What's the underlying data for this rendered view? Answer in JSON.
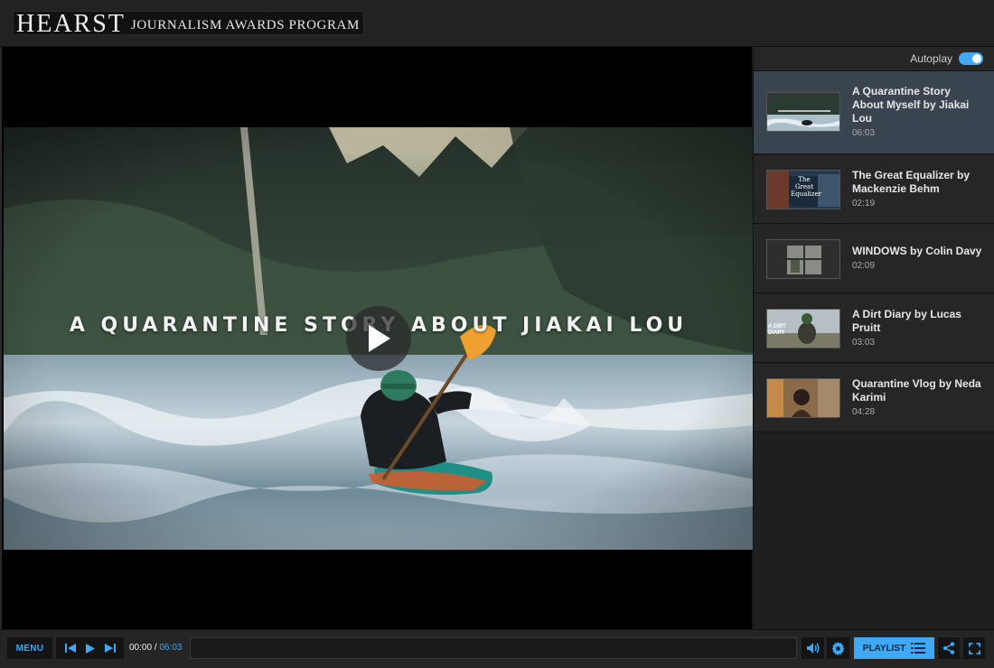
{
  "header": {
    "logo_main": "HEARST",
    "logo_sub": "JOURNALISM AWARDS PROGRAM"
  },
  "video": {
    "title_overlay": "A QUARANTINE STORY ABOUT JIAKAI LOU"
  },
  "sidebar": {
    "autoplay_label": "Autoplay",
    "autoplay_on": true,
    "items": [
      {
        "title": "A Quarantine Story About Myself by Jiakai Lou",
        "duration": "06:03",
        "active": true
      },
      {
        "title": "The Great Equalizer by Mackenzie Behm",
        "duration": "02:19",
        "thumb_text": "The Great Equalizer"
      },
      {
        "title": "WINDOWS by Colin Davy",
        "duration": "02:09"
      },
      {
        "title": "A Dirt Diary by Lucas Pruitt",
        "duration": "03:03",
        "thumb_text": "A DIRT DIARY"
      },
      {
        "title": "Quarantine Vlog by Neda Karimi",
        "duration": "04:28"
      }
    ]
  },
  "controls": {
    "menu_label": "MENU",
    "current_time": "00:00",
    "separator": " / ",
    "duration": "06:03",
    "playlist_label": "PLAYLIST",
    "progress": 0
  },
  "colors": {
    "accent": "#3fa9f5",
    "active_item_bg": "#3a444e",
    "bar_bg": "#252525"
  },
  "icons": [
    "play-icon",
    "skip-back-icon",
    "skip-forward-icon",
    "volume-icon",
    "gear-icon",
    "list-icon",
    "share-icon",
    "fullscreen-icon"
  ]
}
